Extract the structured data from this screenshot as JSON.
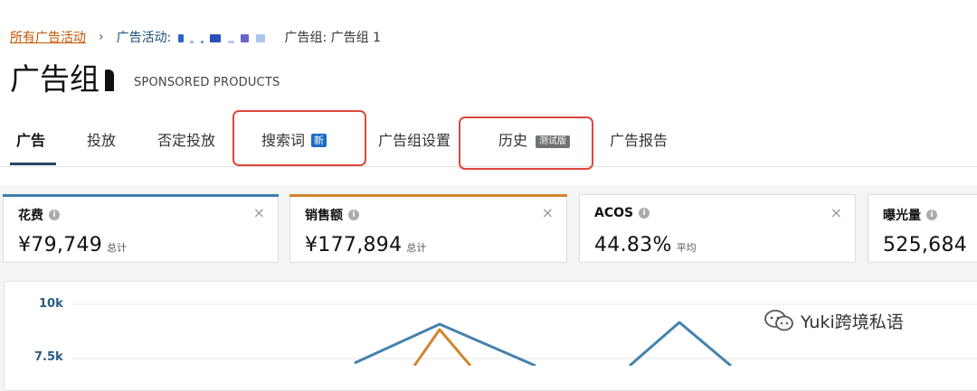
{
  "breadcrumb": {
    "all_campaigns": "所有广告活动",
    "separator": "›",
    "campaign": "广告活动:",
    "ad_group": "广告组: 广告组 1"
  },
  "page": {
    "title": "广告组",
    "subtitle": "SPONSORED PRODUCTS"
  },
  "tabs": [
    {
      "label": "广告"
    },
    {
      "label": "投放"
    },
    {
      "label": "否定投放"
    },
    {
      "label": "搜索词",
      "badge": "新"
    },
    {
      "label": "广告组设置"
    },
    {
      "label": "历史",
      "badge": "测试版"
    },
    {
      "label": "广告报告"
    }
  ],
  "metrics": [
    {
      "label": "花费",
      "value": "¥79,749",
      "unit": "总计",
      "accent": "#3d7fb0"
    },
    {
      "label": "销售额",
      "value": "¥177,894",
      "unit": "总计",
      "accent": "#d2832d"
    },
    {
      "label": "ACOS",
      "value": "44.83%",
      "unit": "平均"
    },
    {
      "label": "曝光量",
      "value": "525,684"
    }
  ],
  "icons": {
    "info": "i",
    "close": "×"
  },
  "chart_data": {
    "type": "line",
    "yticks": [
      "10k",
      "7.5k"
    ],
    "series": [
      {
        "color": "#4682ad"
      },
      {
        "color": "#d2852e"
      }
    ]
  },
  "watermark": "Yuki跨境私语"
}
